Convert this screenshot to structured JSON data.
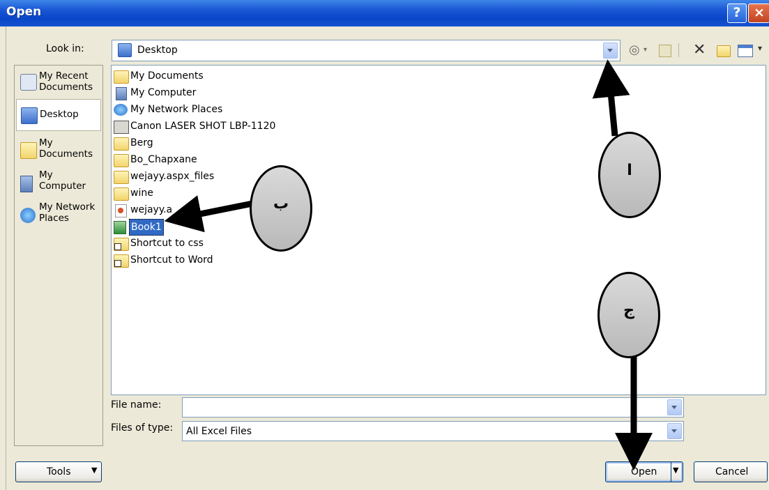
{
  "window": {
    "title": "Open",
    "help": "?",
    "close": "×"
  },
  "lookin": {
    "label": "Look in:",
    "value": "Desktop"
  },
  "places": [
    {
      "name": "My Recent Documents",
      "line1": "My Recent",
      "line2": "Documents",
      "icon": "recent-documents-icon"
    },
    {
      "name": "Desktop",
      "line1": "Desktop",
      "line2": "",
      "icon": "desktop-icon"
    },
    {
      "name": "My Documents",
      "line1": "My",
      "line2": "Documents",
      "icon": "my-documents-icon"
    },
    {
      "name": "My Computer",
      "line1": "My",
      "line2": "Computer",
      "icon": "my-computer-icon"
    },
    {
      "name": "My Network Places",
      "line1": "My Network",
      "line2": "Places",
      "icon": "network-places-icon"
    }
  ],
  "files": [
    {
      "name": "My Documents",
      "icon": "my-documents-icon"
    },
    {
      "name": "My Computer",
      "icon": "my-computer-icon"
    },
    {
      "name": "My Network Places",
      "icon": "network-places-icon"
    },
    {
      "name": "Canon LASER SHOT LBP-1120",
      "icon": "printer-icon"
    },
    {
      "name": "Berg",
      "icon": "folder-icon"
    },
    {
      "name": "Bo_Chapxane",
      "icon": "folder-icon"
    },
    {
      "name": "wejayy.aspx_files",
      "icon": "folder-icon"
    },
    {
      "name": "wine",
      "icon": "folder-icon"
    },
    {
      "name": "wejayy.a",
      "icon": "web-file-icon"
    },
    {
      "name": "Book1",
      "icon": "excel-file-icon",
      "selected": true
    },
    {
      "name": "Shortcut to css",
      "icon": "folder-shortcut-icon"
    },
    {
      "name": "Shortcut to Word",
      "icon": "folder-shortcut-icon"
    }
  ],
  "filename": {
    "label": "File name:",
    "value": ""
  },
  "filetype": {
    "label": "Files of type:",
    "value": "All Excel Files"
  },
  "buttons": {
    "tools": "Tools",
    "open": "Open",
    "cancel": "Cancel"
  },
  "annotations": {
    "a": "ا",
    "b": "ب",
    "c": "ج"
  }
}
